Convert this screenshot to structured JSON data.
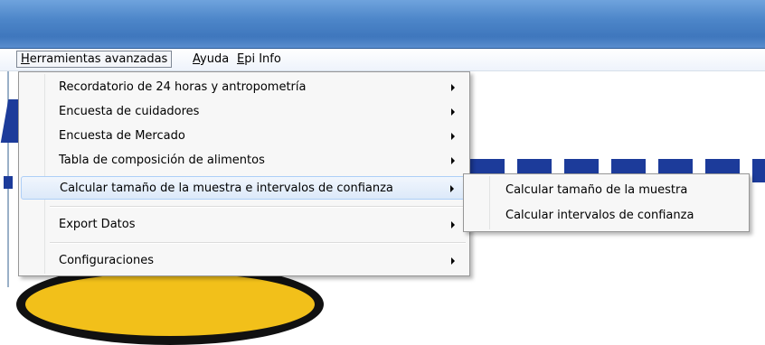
{
  "menubar": {
    "items": [
      {
        "mnemonic": "H",
        "rest": "erramientas avanzadas"
      },
      {
        "mnemonic": "A",
        "rest": "yuda"
      },
      {
        "mnemonic": "E",
        "rest": "pi Info"
      }
    ]
  },
  "menu": {
    "items": [
      {
        "label": "Recordatorio de 24 horas y antropometría",
        "has_submenu": true
      },
      {
        "label": "Encuesta de cuidadores",
        "has_submenu": true
      },
      {
        "label": "Encuesta de Mercado",
        "has_submenu": true
      },
      {
        "label": "Tabla de composición de alimentos",
        "has_submenu": true
      },
      {
        "label": "Calcular tamaño de la muestra e intervalos de confianza",
        "has_submenu": true,
        "highlighted": true
      },
      {
        "label": "Export Datos",
        "has_submenu": true
      },
      {
        "label": "Configuraciones",
        "has_submenu": true
      }
    ]
  },
  "submenu": {
    "items": [
      {
        "label": "Calcular tamaño de la muestra"
      },
      {
        "label": "Calcular intervalos de confianza"
      }
    ]
  },
  "colors": {
    "titlebar": "#4d86c9",
    "menu_background": "#f7f7f7",
    "highlight": "#dce9f9",
    "brand_blue": "#1c3b9a",
    "logo_yellow": "#f2c01a"
  }
}
